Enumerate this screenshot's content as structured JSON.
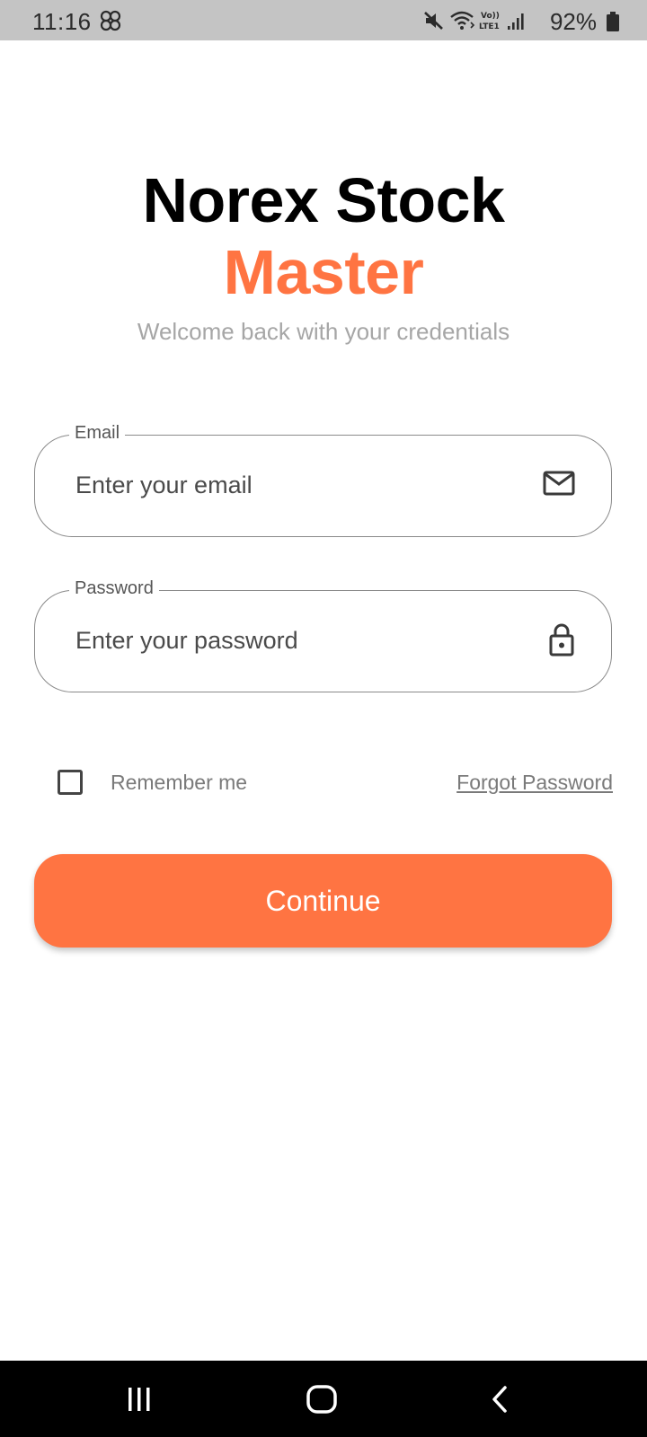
{
  "status_bar": {
    "time": "11:16",
    "battery": "92%",
    "icons": [
      "app-notification-icon",
      "mute-icon",
      "wifi-icon",
      "volte-lte-icon",
      "signal-icon",
      "battery-icon"
    ]
  },
  "header": {
    "title_line1": "Norex Stock",
    "title_line2": "Master",
    "subtitle": "Welcome back with your credentials"
  },
  "form": {
    "email": {
      "label": "Email",
      "placeholder": "Enter your email",
      "icon": "mail-icon"
    },
    "password": {
      "label": "Password",
      "placeholder": "Enter your password",
      "icon": "lock-icon"
    },
    "remember_label": "Remember me",
    "remember_checked": false,
    "forgot_label": "Forgot Password",
    "continue_label": "Continue"
  },
  "colors": {
    "accent": "#ff7442",
    "title": "#000000",
    "subtitle": "#a6a6a6",
    "status_bar_bg": "#c4c4c4",
    "nav_bar_bg": "#000000"
  },
  "nav_bar": {
    "buttons": [
      "recents-icon",
      "home-icon",
      "back-icon"
    ]
  }
}
